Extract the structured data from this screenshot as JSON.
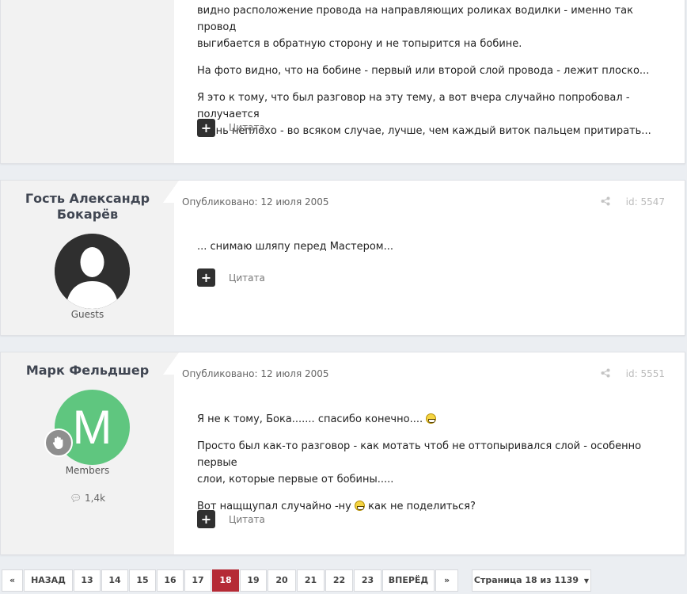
{
  "posts": [
    {
      "paragraphs": [
        "видно расположение провода на направляющих роликах водилки - именно так провод",
        "выгибается в обратную сторону и не топырится на бобине.",
        "На фото видно, что на бобине - первый или второй слой провода - лежит плоско...",
        "Я это к тому, что был разговор на эту тему, а вот вчера случайно попробовал - получается",
        "очень неплохо - во всяком случае, лучше, чем каждый виток пальцем притирать..."
      ],
      "quote_label": "Цитата"
    },
    {
      "author": [
        "Гость Александр",
        "Бокарёв"
      ],
      "group": "Guests",
      "published": "Опубликовано: 12 июля 2005",
      "id_label": "id: 5547",
      "text": "... снимаю шляпу перед Мастером...",
      "quote_label": "Цитата"
    },
    {
      "author": "Марк Фельдшер",
      "avatar_letter": "M",
      "group": "Members",
      "reputation": "1,4k",
      "published": "Опубликовано: 12 июля 2005",
      "id_label": "id: 5551",
      "line1": "Я не к тому, Бока....... спасибо конечно....",
      "line2a": "Просто был как-то разговор - как мотать чтоб не оттопыривался слой - особенно первые",
      "line2b": "слои, которые первые от бобины.....",
      "line3a": "Вот нащщупал случайно -ну",
      "line3b": "как не поделиться?",
      "quote_label": "Цитата"
    }
  ],
  "pagination": {
    "first": "«",
    "prev": "НАЗАД",
    "pages": [
      "13",
      "14",
      "15",
      "16",
      "17",
      "18",
      "19",
      "20",
      "21",
      "22",
      "23"
    ],
    "active": "18",
    "next": "ВПЕРЁД",
    "last": "»",
    "jump": "Страница 18 из 1139"
  },
  "colors": {
    "accent": "#b52a35",
    "avatar_green": "#5fc67f"
  }
}
